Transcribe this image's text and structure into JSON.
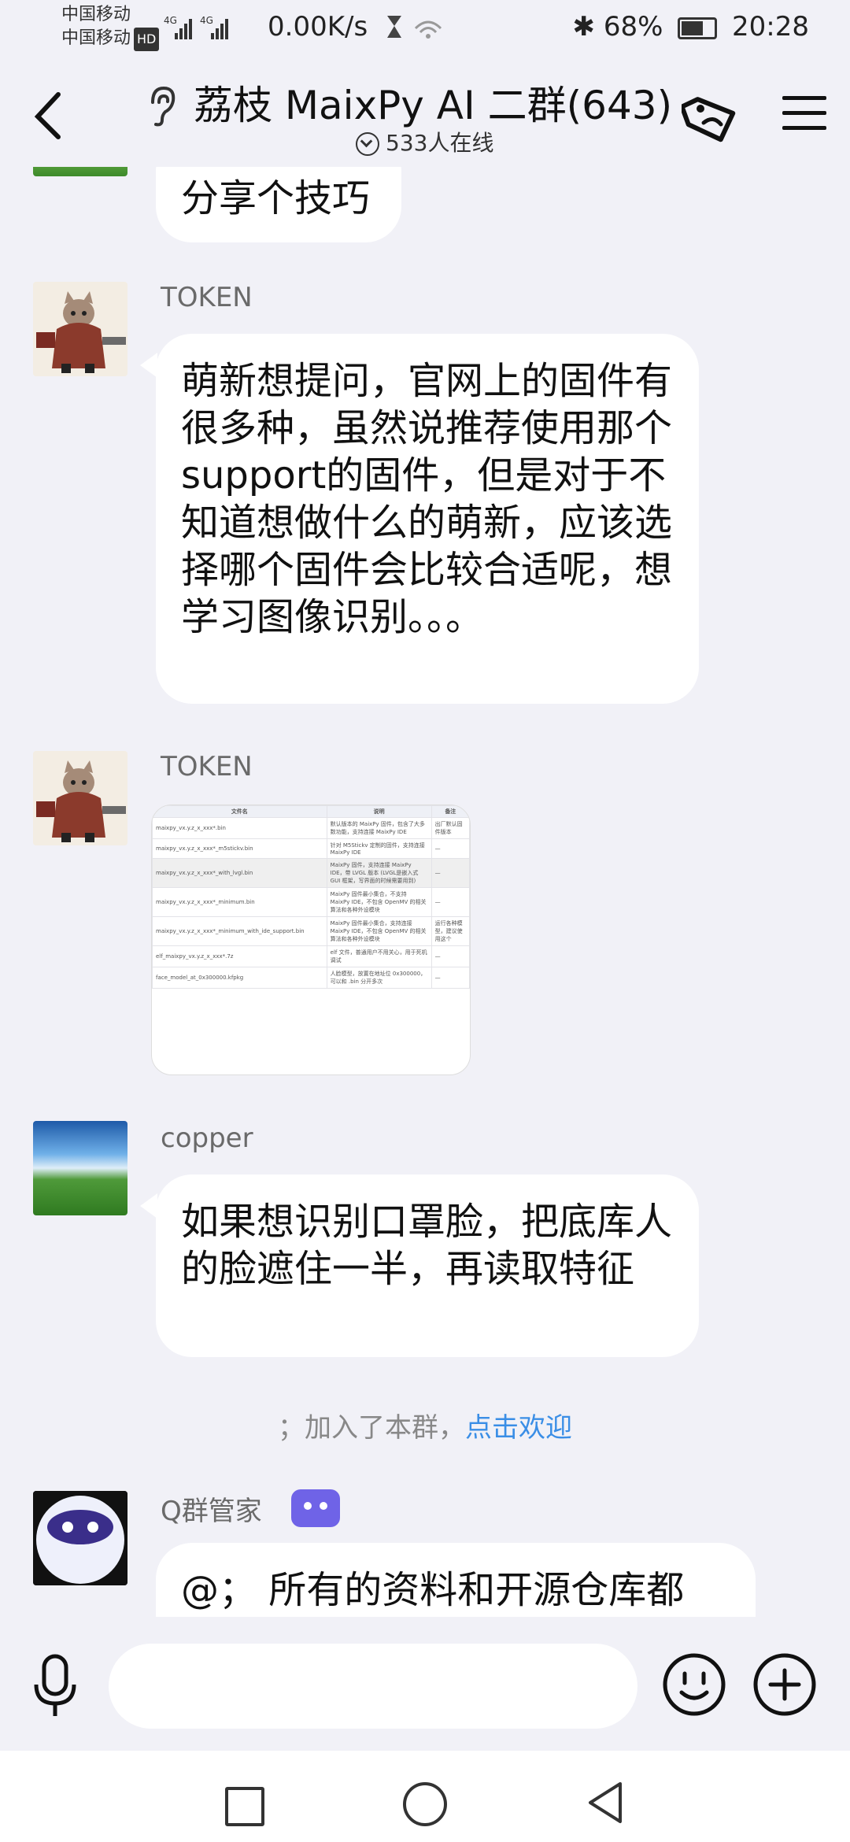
{
  "status_bar": {
    "carrier_1": "中国移动",
    "carrier_2": "中国移动",
    "hd": "HD",
    "net_speed": "0.00K/s",
    "battery_percent": "68%",
    "battery_level": 0.68,
    "time": "20:28"
  },
  "header": {
    "title": "荔枝 MaixPy AI 二群(643)",
    "online": "533人在线"
  },
  "messages": [
    {
      "text": "分享个技巧"
    },
    {
      "sender": "TOKEN",
      "text": "萌新想提问，官网上的固件有很多种，虽然说推荐使用那个support的固件，但是对于不知道想做什么的萌新，应该选择哪个固件会比较合适呢，想学习图像识别。。。"
    },
    {
      "sender": "TOKEN",
      "image": {
        "headers": [
          "文件名",
          "说明",
          "备注"
        ],
        "rows": [
          [
            "maixpy_vx.y.z_x_xxx*.bin",
            "默认版本的 MaixPy 固件，包含了大多数功能，支持连接 MaixPy IDE",
            "出厂默认固件版本"
          ],
          [
            "maixpy_vx.y.z_x_xxx*_m5stickv.bin",
            "针对 M5Stickv 定制的固件，支持连接 MaixPy IDE",
            "—"
          ],
          [
            "maixpy_vx.y.z_x_xxx*_with_lvgl.bin",
            "MaixPy 固件，支持连接 MaixPy IDE，带 LVGL 版本 (LVGL是嵌入式 GUI 框架，写界面的时候需要用到)",
            "—"
          ],
          [
            "maixpy_vx.y.z_x_xxx*_minimum.bin",
            "MaixPy 固件最小集合，不支持 MaixPy IDE，不包含 OpenMV 的相关算法和各种外设模块",
            "—"
          ],
          [
            "maixpy_vx.y.z_x_xxx*_minimum_with_ide_support.bin",
            "MaixPy 固件最小集合，支持连接 MaixPy IDE，不包含 OpenMV 的相关算法和各种外设模块",
            "运行各种模型，建议使用这个"
          ],
          [
            "elf_maixpy_vx.y.z_x_xxx*.7z",
            "elf 文件，普通用户不用关心，用于死机调试",
            "—"
          ],
          [
            "face_model_at_0x300000.kfpkg",
            "人脸模型，放置在地址位 0x300000，可以和 .bin 分开多次",
            "—"
          ]
        ]
      }
    },
    {
      "sender": "copper",
      "text": "如果想识别口罩脸，把底库人的脸遮住一半，再读取特征"
    },
    {
      "sender": "Q群管家",
      "text": "@；  所有的资料和开源仓库都"
    }
  ],
  "system_notice": {
    "text": "；加入了本群，",
    "link": "点击欢迎"
  },
  "input": {
    "placeholder": ""
  },
  "colors": {
    "background": "#f1f1f7",
    "link": "#3a8ee6",
    "robot_badge": "#6f63e7"
  }
}
